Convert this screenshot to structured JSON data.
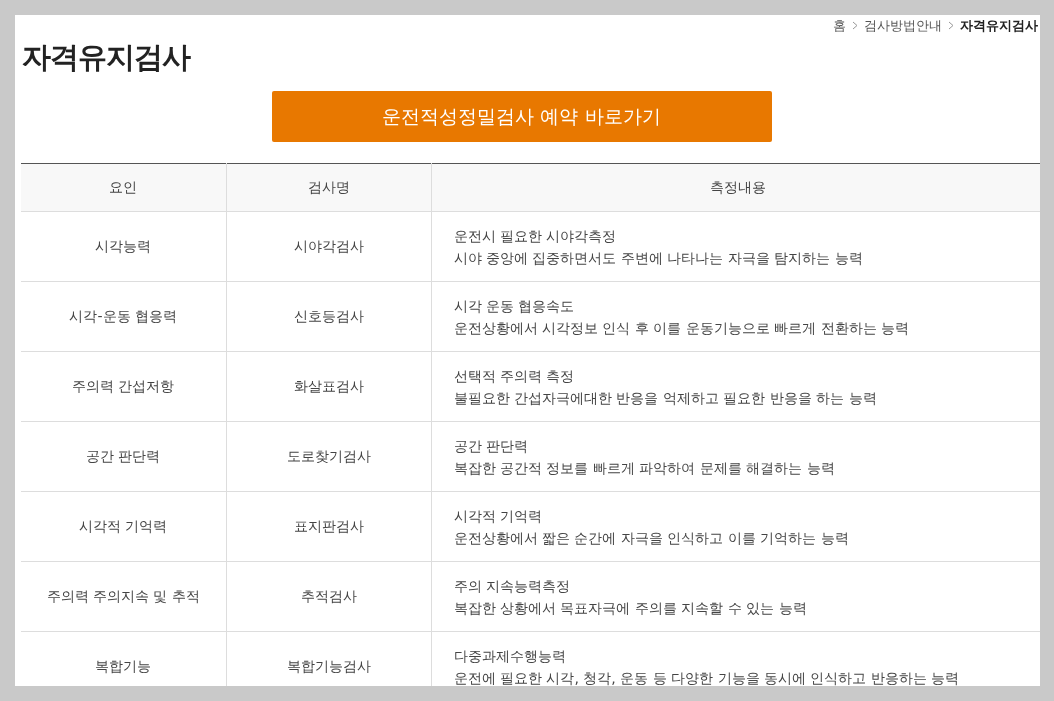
{
  "breadcrumb": [
    {
      "label": "홈",
      "current": false
    },
    {
      "label": "검사방법안내",
      "current": false
    },
    {
      "label": "자격유지검사",
      "current": true
    }
  ],
  "title": "자격유지검사",
  "cta_button": "운전적성정밀검사 예약 바로가기",
  "table": {
    "columns": [
      "요인",
      "검사명",
      "측정내용"
    ],
    "rows": [
      {
        "factor": "시각능력",
        "test": "시야각검사",
        "lines": [
          "운전시 필요한 시야각측정",
          "시야 중앙에 집중하면서도 주변에 나타나는 자극을 탐지하는 능력"
        ]
      },
      {
        "factor": "시각-운동 협응력",
        "test": "신호등검사",
        "lines": [
          "시각 운동 협응속도",
          "운전상황에서 시각정보 인식 후 이를 운동기능으로 빠르게 전환하는 능력"
        ]
      },
      {
        "factor": "주의력 간섭저항",
        "test": "화살표검사",
        "lines": [
          "선택적 주의력 측정",
          "불필요한 간섭자극에대한 반응을 억제하고 필요한 반응을 하는 능력"
        ]
      },
      {
        "factor": "공간 판단력",
        "test": "도로찾기검사",
        "lines": [
          "공간 판단력",
          "복잡한 공간적 정보를 빠르게 파악하여 문제를 해결하는 능력"
        ]
      },
      {
        "factor": "시각적 기억력",
        "test": "표지판검사",
        "lines": [
          "시각적 기억력",
          "운전상황에서 짧은 순간에 자극을 인식하고 이를 기억하는 능력"
        ]
      },
      {
        "factor": "주의력 주의지속 및 추적",
        "test": "추적검사",
        "lines": [
          "주의 지속능력측정",
          "복잡한 상황에서 목표자극에 주의를 지속할 수 있는 능력"
        ]
      },
      {
        "factor": "복합기능",
        "test": "복합기능검사",
        "lines": [
          "다중과제수행능력",
          "운전에 필요한 시각, 청각, 운동 등 다양한 기능을 동시에 인식하고 반응하는 능력"
        ]
      }
    ]
  }
}
